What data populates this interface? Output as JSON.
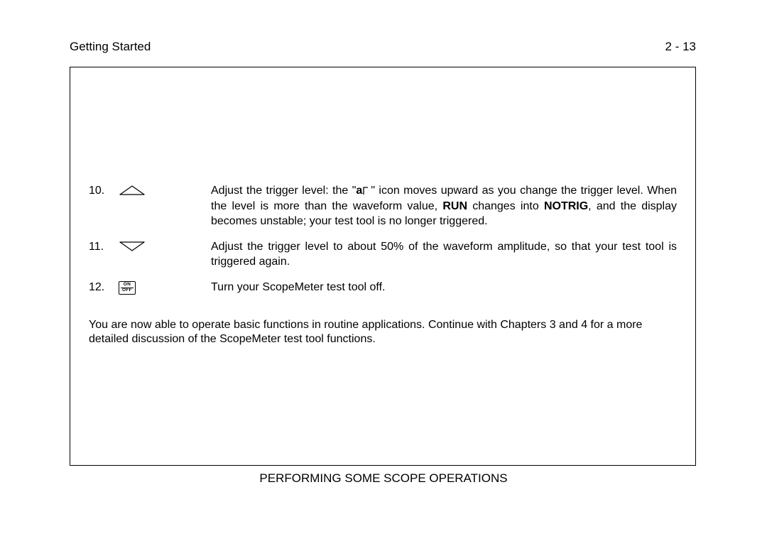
{
  "header": {
    "left": "Getting Started",
    "right": "2 - 13"
  },
  "steps": [
    {
      "num": "10.",
      "icon": "arrow-up",
      "text_parts": {
        "pre": "Adjust the trigger level: the \"",
        "bold_a": "a",
        "mid1": "\" icon moves upward as you change the trigger level. When the level is more than the waveform value, ",
        "bold_run": "RUN",
        "mid2": " changes into ",
        "bold_notrig": "NOTRIG",
        "post": ", and the display becomes unstable; your test tool is no longer triggered."
      }
    },
    {
      "num": "11.",
      "icon": "arrow-down",
      "text": "Adjust the trigger level to about 50% of the waveform amplitude, so that your test tool is triggered again."
    },
    {
      "num": "12.",
      "icon": "onoff",
      "onoff_labels": {
        "on": "ON",
        "off": "OFF"
      },
      "text": "Turn your ScopeMeter test tool off."
    }
  ],
  "narrative": "You are now able to operate basic functions in routine applications. Continue with Chapters 3 and 4 for a more detailed discussion of the ScopeMeter test tool functions.",
  "footer": "PERFORMING SOME SCOPE OPERATIONS"
}
